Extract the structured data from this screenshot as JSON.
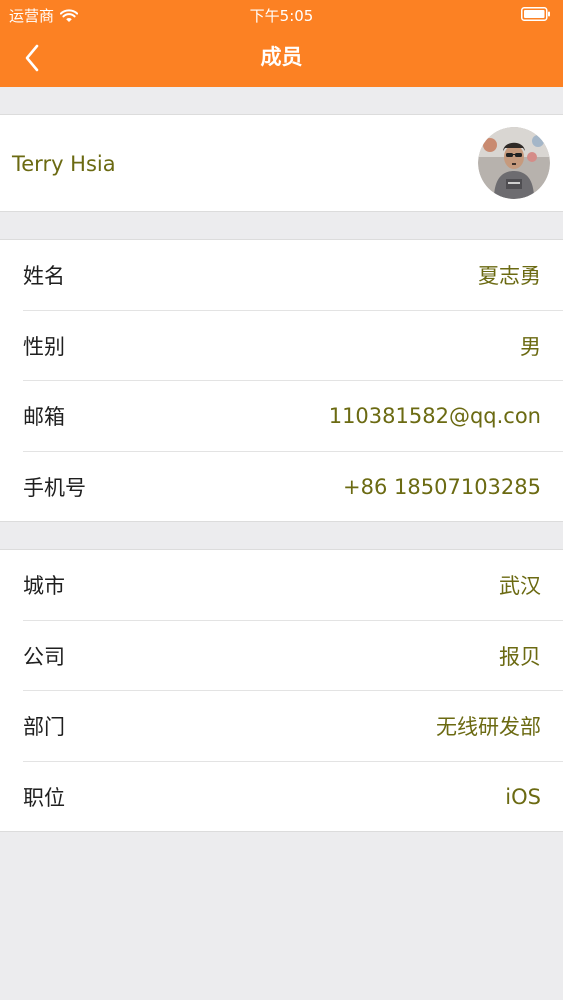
{
  "status_bar": {
    "carrier": "运营商",
    "time": "下午5:05"
  },
  "nav": {
    "title": "成员",
    "back_icon": "chevron-left-icon"
  },
  "profile": {
    "name": "Terry Hsia",
    "avatar_icon": "user-avatar-photo"
  },
  "groups": [
    {
      "rows": [
        {
          "label": "姓名",
          "value": "夏志勇"
        },
        {
          "label": "性别",
          "value": "男"
        },
        {
          "label": "邮箱",
          "value": "110381582@qq.con"
        },
        {
          "label": "手机号",
          "value": "+86 18507103285"
        }
      ]
    },
    {
      "rows": [
        {
          "label": "城市",
          "value": "武汉"
        },
        {
          "label": "公司",
          "value": "报贝"
        },
        {
          "label": "部门",
          "value": "无线研发部"
        },
        {
          "label": "职位",
          "value": "iOS"
        }
      ]
    }
  ],
  "colors": {
    "header": "#fc8123",
    "value_text": "#6b6a12",
    "label_text": "#1f1f1f",
    "background": "#ececee"
  }
}
